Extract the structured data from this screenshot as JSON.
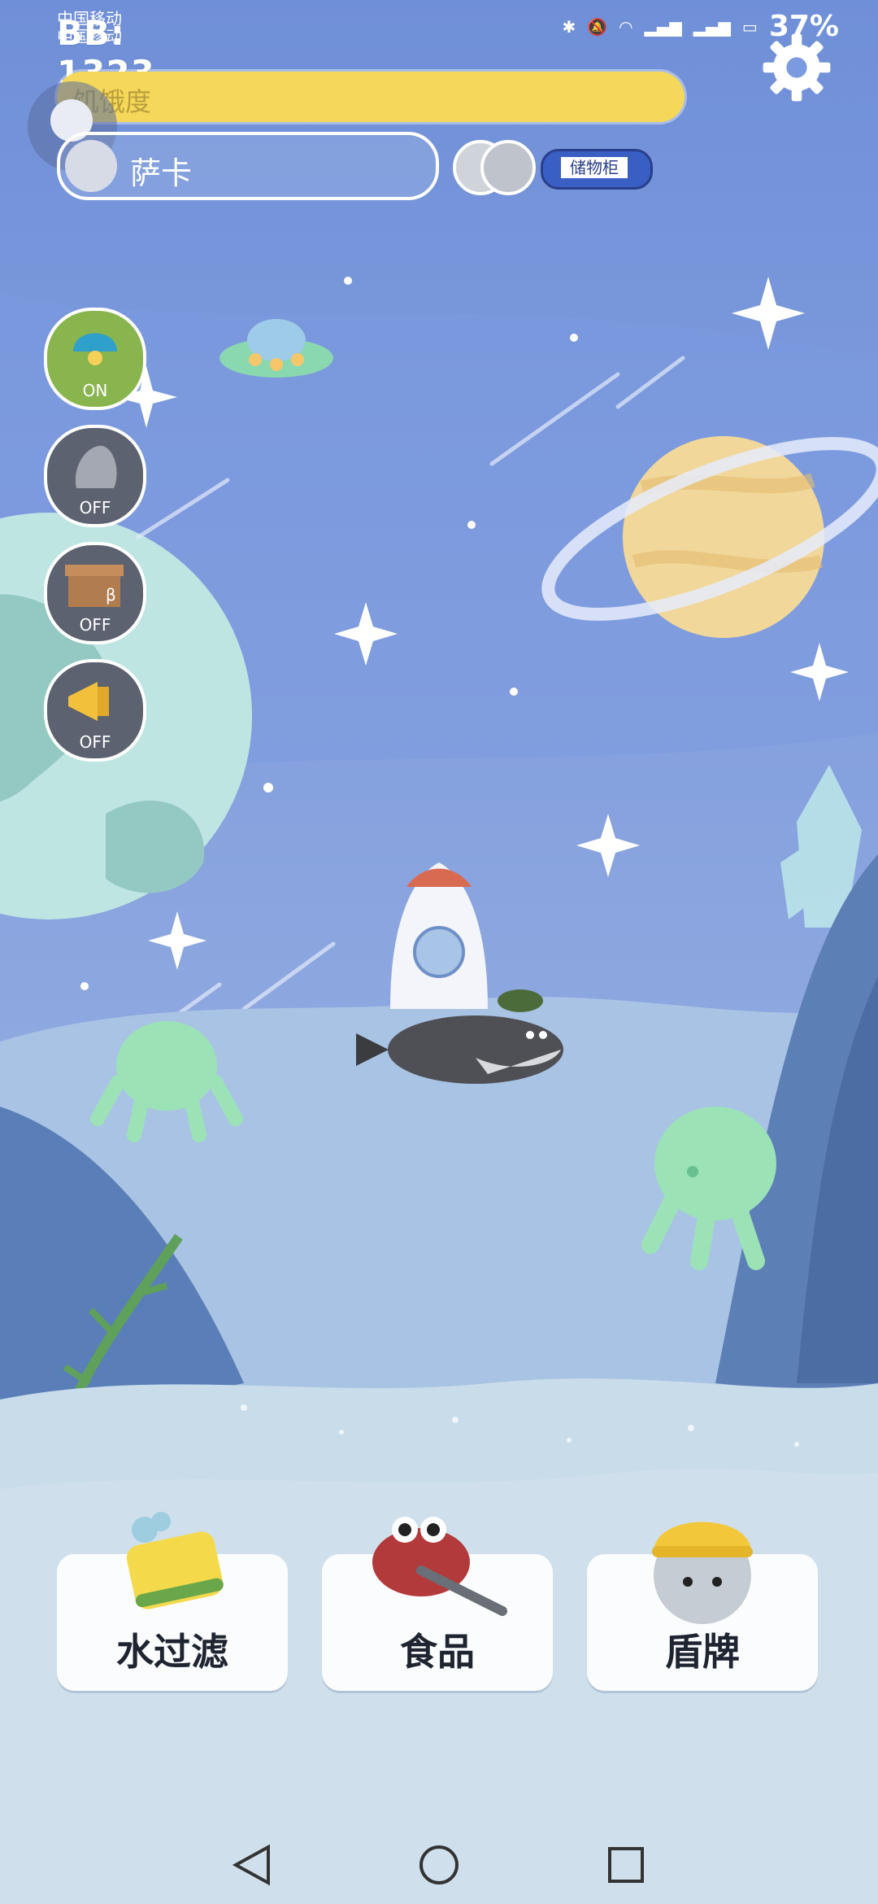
{
  "status_bar": {
    "carrier_1": "中国移动",
    "carrier_2": "中国移动",
    "time": "BB: 1323",
    "battery": "37%"
  },
  "top": {
    "hunger_label": "饥饿度",
    "pet_name": "萨卡",
    "storage_label": "储物柜"
  },
  "side_toggles": [
    {
      "icon": "lamp-icon",
      "state": "ON"
    },
    {
      "icon": "rock-icon",
      "state": "OFF"
    },
    {
      "icon": "box-icon",
      "state": "OFF"
    },
    {
      "icon": "megaphone-icon",
      "state": "OFF"
    }
  ],
  "actions": [
    {
      "label": "水过滤",
      "icon": "sponge-icon"
    },
    {
      "label": "食品",
      "icon": "crab-food-icon"
    },
    {
      "label": "盾牌",
      "icon": "fish-helmet-icon"
    }
  ],
  "colors": {
    "hunger_bar": "#f5d85a",
    "sky_top": "#6f8fd8",
    "ground": "#c9dcea"
  }
}
